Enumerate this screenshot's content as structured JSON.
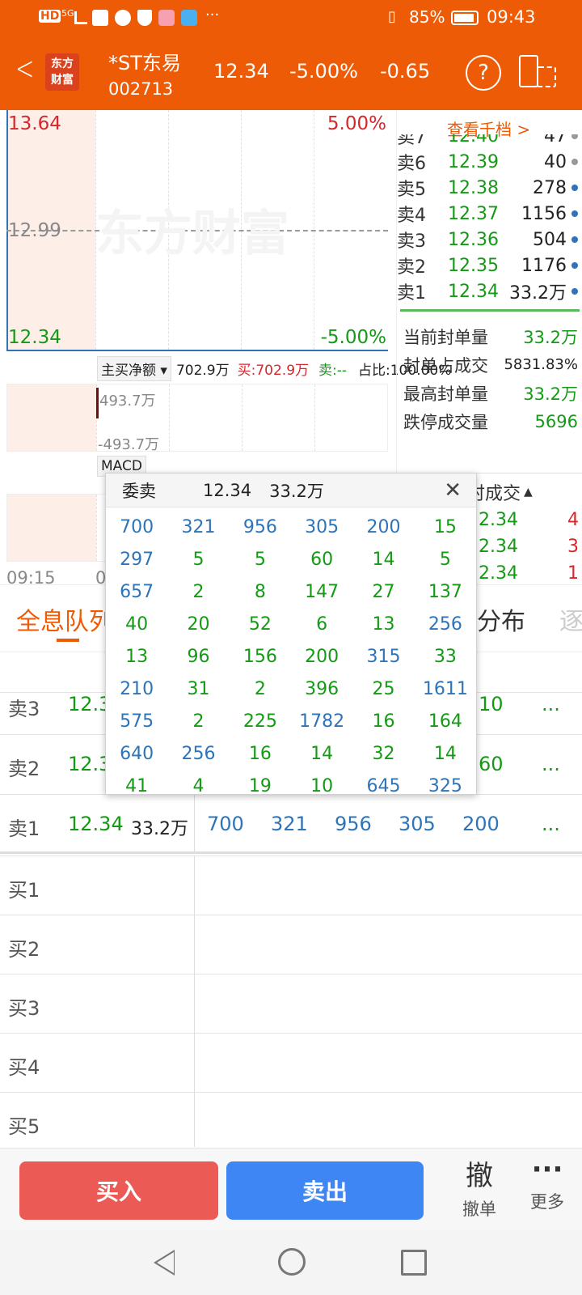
{
  "status": {
    "time": "09:43",
    "battery": "85%",
    "signal": "5G",
    "hd": "HD"
  },
  "header": {
    "back": "<",
    "logo_line1": "东方",
    "logo_line2": "财富",
    "stock_name": "*ST东易",
    "stock_code": "002713",
    "price": "12.34",
    "change_pct": "-5.00%",
    "change": "-0.65",
    "help": "?"
  },
  "chart": {
    "high": "13.64",
    "high_pct": "5.00%",
    "mid": "12.99",
    "low": "12.34",
    "low_pct": "-5.00%",
    "watermark": "东方财富",
    "time_start": "09:15",
    "time_partial": "0"
  },
  "flow": {
    "label": "主买净额",
    "value": "702.9万",
    "buy": "买:702.9万",
    "sell": "卖:--",
    "ratio": "占比:100.00%",
    "axis_top": "493.7万",
    "axis_bottom": "-493.7万"
  },
  "macd": {
    "label": "MACD"
  },
  "orderbook": {
    "view_more": "查看千档 >",
    "rows": [
      {
        "label": "卖7",
        "price": "12.40",
        "vol": "47"
      },
      {
        "label": "卖6",
        "price": "12.39",
        "vol": "40"
      },
      {
        "label": "卖5",
        "price": "12.38",
        "vol": "278"
      },
      {
        "label": "卖4",
        "price": "12.37",
        "vol": "1156"
      },
      {
        "label": "卖3",
        "price": "12.36",
        "vol": "504"
      },
      {
        "label": "卖2",
        "price": "12.35",
        "vol": "1176"
      },
      {
        "label": "卖1",
        "price": "12.34",
        "vol": "33.2万"
      }
    ]
  },
  "seal": {
    "rows": [
      {
        "label": "当前封单量",
        "value": "33.2万"
      },
      {
        "label": "封单占成交",
        "value": "5831.83%"
      },
      {
        "label": "最高封单量",
        "value": "33.2万"
      },
      {
        "label": "跌停成交量",
        "value": "5696"
      }
    ]
  },
  "ticks": {
    "header": "时成交",
    "rows": [
      {
        "price": "12.34",
        "vol": "4"
      },
      {
        "price": "12.34",
        "vol": "3"
      },
      {
        "price": "12.34",
        "vol": "1"
      }
    ]
  },
  "tabs": {
    "queue": "全息队列",
    "dist": "分布",
    "partial": "逐"
  },
  "queue": {
    "sell3": {
      "label": "卖3",
      "price": "12.3",
      "tail": "10",
      "more": "..."
    },
    "sell2": {
      "label": "卖2",
      "price": "12.3",
      "tail": "60",
      "more": "..."
    },
    "sell1": {
      "label": "卖1",
      "price": "12.34",
      "vol": "33.2万",
      "items": [
        "700",
        "321",
        "956",
        "305",
        "200"
      ],
      "more": "..."
    },
    "buys": [
      "买1",
      "买2",
      "买3",
      "买4",
      "买5"
    ]
  },
  "popup": {
    "title": "委卖",
    "price": "12.34",
    "vol": "33.2万",
    "close": "✕",
    "cells": [
      "700",
      "321",
      "956",
      "305",
      "200",
      "15",
      "297",
      "5",
      "5",
      "60",
      "14",
      "5",
      "657",
      "2",
      "8",
      "147",
      "27",
      "137",
      "40",
      "20",
      "52",
      "6",
      "13",
      "256",
      "13",
      "96",
      "156",
      "200",
      "315",
      "33",
      "210",
      "31",
      "2",
      "396",
      "25",
      "1611",
      "575",
      "2",
      "225",
      "1782",
      "16",
      "164",
      "640",
      "256",
      "16",
      "14",
      "32",
      "14",
      "41",
      "4",
      "19",
      "10",
      "645",
      "325"
    ],
    "colors": [
      "b",
      "b",
      "b",
      "b",
      "b",
      "g",
      "b",
      "g",
      "g",
      "g",
      "g",
      "g",
      "b",
      "g",
      "g",
      "g",
      "g",
      "g",
      "g",
      "g",
      "g",
      "g",
      "g",
      "b",
      "g",
      "g",
      "g",
      "g",
      "b",
      "g",
      "b",
      "g",
      "g",
      "g",
      "g",
      "b",
      "b",
      "g",
      "g",
      "b",
      "g",
      "g",
      "b",
      "b",
      "g",
      "g",
      "g",
      "g",
      "g",
      "g",
      "g",
      "g",
      "b",
      "b"
    ]
  },
  "bottom": {
    "buy": "买入",
    "sell": "卖出",
    "cancel_icon": "撤",
    "cancel": "撤单",
    "more_icon": "···",
    "more": "更多"
  }
}
